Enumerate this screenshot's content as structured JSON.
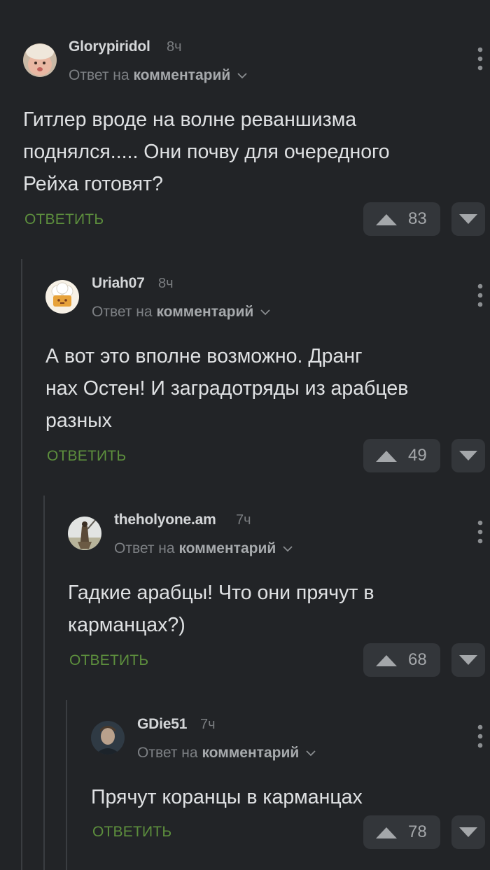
{
  "labels": {
    "reply_to_prefix": "Ответ на",
    "reply_to_target": "комментарий",
    "reply_button": "ответить"
  },
  "comments": [
    {
      "username": "Glorypiridol",
      "time": "8ч",
      "text_lines": [
        "Гитлер вроде на волне реваншизма",
        "поднялся..... Они почву для очередного",
        "Рейха готовят?"
      ],
      "rating": "83",
      "avatar": "baby-avatar"
    },
    {
      "username": "Uriah07",
      "time": "8ч",
      "text_lines": [
        "А вот это вполне возможно. Дранг",
        "нах Остен! И заградотряды из арабцев",
        "разных"
      ],
      "rating": "49",
      "avatar": "chef-avatar"
    },
    {
      "username": "theholyone.am",
      "time": "7ч",
      "text_lines": [
        "Гадкие арабцы! Что они прячут в",
        "карманцах?)"
      ],
      "rating": "68",
      "avatar": "warrior-avatar"
    },
    {
      "username": "GDie51",
      "time": "7ч",
      "text_lines": [
        "Прячут коранцы в карманцах"
      ],
      "rating": "78",
      "avatar": "man-avatar"
    }
  ],
  "colors": {
    "background": "#222427",
    "reply_green": "#5d8f3d",
    "button_bg": "#33363a"
  }
}
